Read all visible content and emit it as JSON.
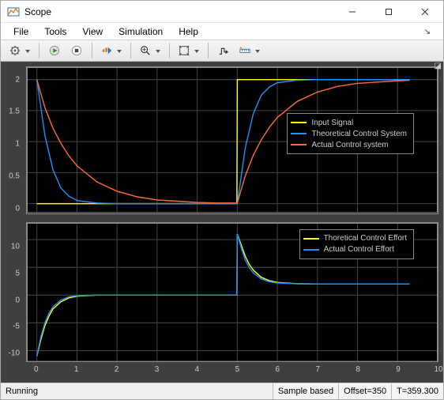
{
  "window": {
    "title": "Scope"
  },
  "menu": {
    "file": "File",
    "tools": "Tools",
    "view": "View",
    "simulation": "Simulation",
    "help": "Help"
  },
  "axes1": {
    "yticks": [
      0,
      0.5,
      1,
      1.5,
      2
    ],
    "ylabels": [
      "0",
      "0.5",
      "1",
      "1.5",
      "2"
    ],
    "ylim": [
      -0.15,
      2.2
    ],
    "legend": {
      "items": [
        {
          "label": "Input Signal",
          "color": "#ffff00"
        },
        {
          "label": "Theoretical Control System",
          "color": "#1e90ff"
        },
        {
          "label": "Actual Control system",
          "color": "#ff6a3c"
        }
      ]
    }
  },
  "axes2": {
    "yticks": [
      -10,
      -5,
      0,
      5,
      10
    ],
    "ylabels": [
      "-10",
      "-5",
      "0",
      "5",
      "10"
    ],
    "ylim": [
      -12,
      13
    ],
    "legend": {
      "items": [
        {
          "label": "Thoretical Control Effort",
          "color": "#ffff00"
        },
        {
          "label": "Actual Control Effort",
          "color": "#1e90ff"
        }
      ]
    }
  },
  "xaxis": {
    "ticks": [
      0,
      1,
      2,
      3,
      4,
      5,
      6,
      7,
      8,
      9,
      10
    ],
    "lim": [
      -0.25,
      10
    ]
  },
  "status": {
    "running": "Running",
    "sample": "Sample based",
    "offset": "Offset=350",
    "time": "T=359.300"
  },
  "chart_data": [
    {
      "type": "line",
      "title": "",
      "xlabel": "",
      "ylabel": "",
      "xlim": [
        -0.25,
        10
      ],
      "ylim": [
        -0.15,
        2.2
      ],
      "x": [
        0,
        0.2,
        0.4,
        0.6,
        0.8,
        1,
        1.5,
        2,
        2.5,
        3,
        3.5,
        4,
        4.5,
        4.99,
        5,
        5.2,
        5.4,
        5.6,
        5.8,
        6,
        6.5,
        7,
        7.5,
        8,
        8.5,
        9,
        9.3
      ],
      "series": [
        {
          "name": "Input Signal",
          "color": "#ffff00",
          "values": [
            0,
            0,
            0,
            0,
            0,
            0,
            0,
            0,
            0,
            0,
            0,
            0,
            0,
            0,
            2,
            2,
            2,
            2,
            2,
            2,
            2,
            2,
            2,
            2,
            2,
            2,
            2
          ]
        },
        {
          "name": "Theoretical Control System",
          "color": "#1e90ff",
          "values": [
            2,
            1.1,
            0.55,
            0.25,
            0.12,
            0.05,
            0.01,
            0,
            0,
            0,
            0,
            0,
            0,
            0,
            0,
            0.9,
            1.45,
            1.75,
            1.88,
            1.95,
            1.99,
            2,
            2,
            2,
            2,
            2,
            2
          ]
        },
        {
          "name": "Actual Control system",
          "color": "#ff6a3c",
          "values": [
            2,
            1.55,
            1.22,
            0.97,
            0.77,
            0.61,
            0.35,
            0.2,
            0.11,
            0.06,
            0.04,
            0.02,
            0.01,
            0.01,
            0.01,
            0.45,
            0.78,
            1.03,
            1.23,
            1.39,
            1.65,
            1.8,
            1.89,
            1.94,
            1.96,
            1.98,
            1.99
          ]
        }
      ]
    },
    {
      "type": "line",
      "title": "",
      "xlabel": "",
      "ylabel": "",
      "xlim": [
        -0.25,
        10
      ],
      "ylim": [
        -12,
        13
      ],
      "x": [
        0,
        0.1,
        0.2,
        0.3,
        0.4,
        0.6,
        0.8,
        1,
        1.5,
        2,
        3,
        4,
        4.99,
        5,
        5.1,
        5.2,
        5.3,
        5.4,
        5.6,
        5.8,
        6,
        6.5,
        7,
        8,
        9,
        9.3
      ],
      "series": [
        {
          "name": "Thoretical Control Effort",
          "color": "#ffff00",
          "values": [
            -11,
            -8,
            -5.5,
            -3.8,
            -2.5,
            -1.2,
            -0.5,
            -0.2,
            0,
            0,
            0,
            0,
            0,
            11,
            9,
            7,
            5.5,
            4.5,
            3.2,
            2.6,
            2.3,
            2.05,
            2,
            2,
            2,
            2
          ]
        },
        {
          "name": "Actual Control Effort",
          "color": "#1e90ff",
          "values": [
            -11,
            -7.5,
            -5,
            -3.3,
            -2.1,
            -0.9,
            -0.3,
            -0.1,
            0,
            0,
            0,
            0,
            0,
            11,
            8.5,
            6.3,
            4.9,
            4.0,
            2.9,
            2.4,
            2.2,
            2.03,
            2,
            2,
            2,
            2
          ]
        }
      ]
    }
  ]
}
